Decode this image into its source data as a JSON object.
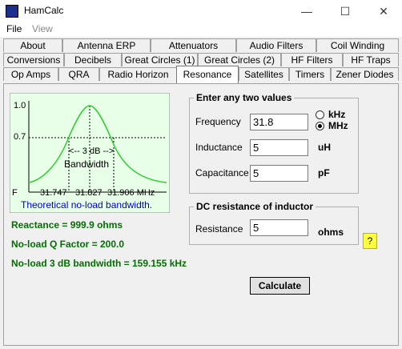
{
  "window": {
    "title": "HamCalc",
    "minimize": "—",
    "maximize": "☐",
    "close": "✕"
  },
  "menu": {
    "file": "File",
    "view": "View"
  },
  "tabs": {
    "row1": [
      "About",
      "Antenna ERP",
      "Attenuators",
      "Audio Filters",
      "Coil Winding"
    ],
    "row2": [
      "Conversions",
      "Decibels",
      "Great Circles (1)",
      "Great Circles (2)",
      "HF Filters",
      "HF Traps"
    ],
    "row3": [
      "Op Amps",
      "QRA",
      "Radio Horizon",
      "Resonance",
      "Satellites",
      "Timers",
      "Zener Diodes"
    ],
    "active": "Resonance"
  },
  "graph": {
    "y1": "1.0",
    "y2": "0.7",
    "f_label": "F",
    "bw_arrow": "<-- 3 dB -->",
    "bw_label": "Bandwidth",
    "x1": "31.747",
    "x2": "31.827",
    "x3": "31.906 MHz",
    "caption": "Theoretical no-load bandwidth."
  },
  "inputs": {
    "group_title": "Enter any two values",
    "frequency_label": "Frequency",
    "frequency_value": "31.8",
    "khz_label": "kHz",
    "mhz_label": "MHz",
    "inductance_label": "Inductance",
    "inductance_value": "5",
    "inductance_unit": "uH",
    "capacitance_label": "Capacitance",
    "capacitance_value": "5",
    "capacitance_unit": "pF"
  },
  "dc": {
    "group_title": "DC resistance of inductor",
    "resistance_label": "Resistance",
    "resistance_value": "5",
    "resistance_unit": "ohms"
  },
  "results": {
    "reactance": "Reactance = 999.9 ohms",
    "q_factor": "No-load Q Factor = 200.0",
    "bandwidth": "No-load 3 dB bandwidth = 159.155 kHz"
  },
  "calculate_label": "Calculate",
  "help_label": "?",
  "colors": {
    "graph_bg": "#e8ffe8",
    "curve": "#2ecc2e",
    "result": "#007000",
    "caption": "#0000c0"
  }
}
